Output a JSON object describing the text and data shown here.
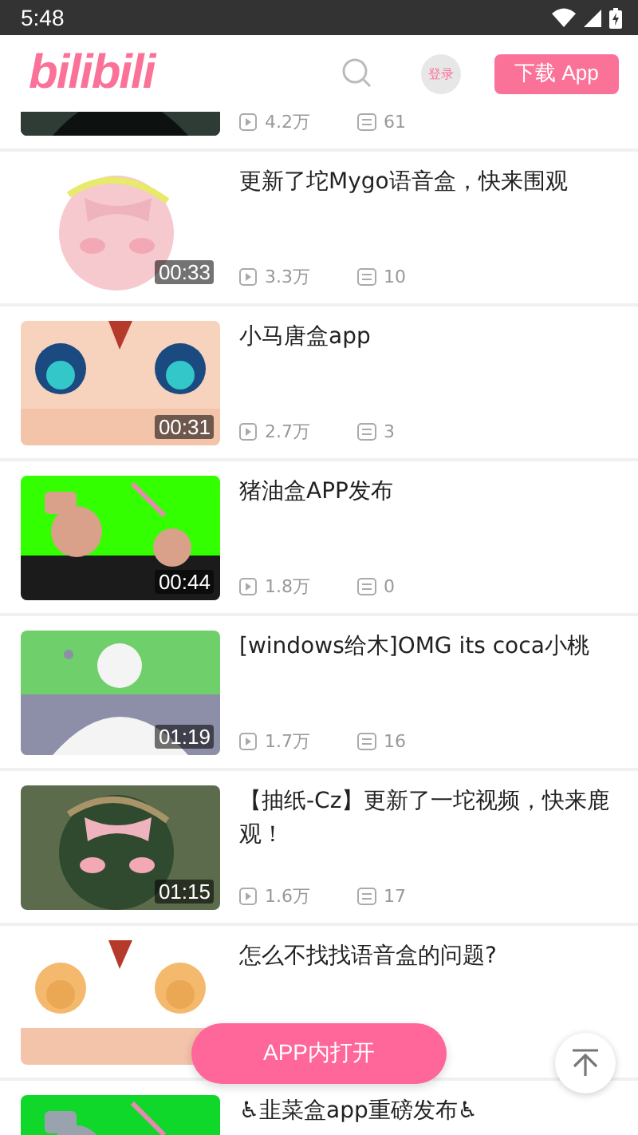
{
  "status_bar": {
    "time": "5:48"
  },
  "header": {
    "logo": "bilibili",
    "login": "登录",
    "download_button": "下载 App"
  },
  "videos": [
    {
      "views": "4.2万",
      "comments": "61"
    },
    {
      "duration": "00:33",
      "title": "更新了坨Mygo语音盒，快来围观",
      "views": "3.3万",
      "comments": "10"
    },
    {
      "duration": "00:31",
      "title": "小马唐盒app",
      "views": "2.7万",
      "comments": "3"
    },
    {
      "duration": "00:44",
      "title": "猪油盒APP发布",
      "views": "1.8万",
      "comments": "0"
    },
    {
      "duration": "01:19",
      "title": "[windows给木]OMG its coca小桃",
      "views": "1.7万",
      "comments": "16"
    },
    {
      "duration": "01:15",
      "title": "【抽纸-Cz】更新了一坨视频，快来鹿观！",
      "views": "1.6万",
      "comments": "17"
    },
    {
      "title": "怎么不找找语音盒的问题?"
    },
    {
      "title": "♿韭菜盒app重磅发布♿"
    }
  ],
  "open_in_app_button": "APP内打开"
}
